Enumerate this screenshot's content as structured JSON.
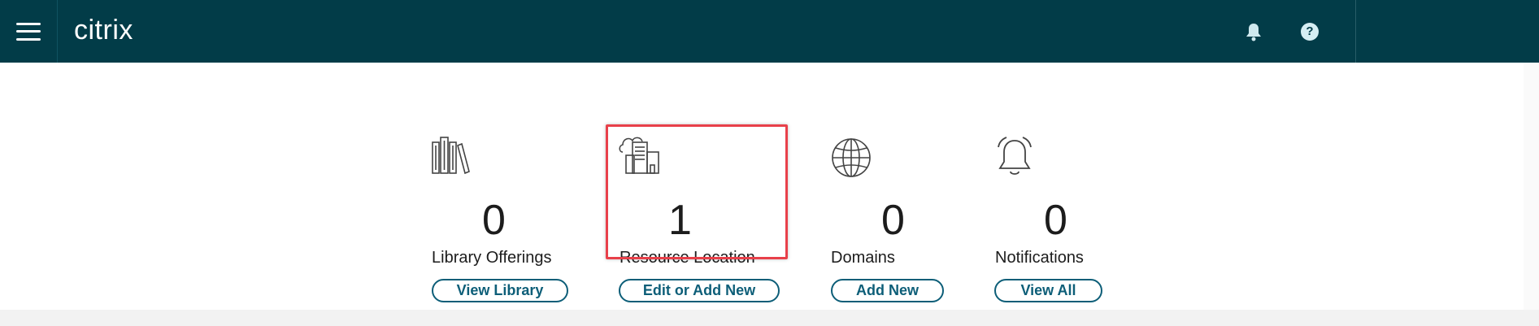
{
  "header": {
    "brand": "citrix",
    "icons": {
      "menu": "hamburger-menu-icon",
      "bell": "bell-icon",
      "help": "help-icon"
    },
    "help_glyph": "?",
    "background": "#023c48"
  },
  "cards": [
    {
      "icon": "library-books-icon",
      "count": "0",
      "label": "Library Offerings",
      "button": "View Library"
    },
    {
      "icon": "cloud-building-icon",
      "count": "1",
      "label": "Resource Location",
      "button": "Edit or Add New"
    },
    {
      "icon": "globe-icon",
      "count": "0",
      "label": "Domains",
      "button": "Add New"
    },
    {
      "icon": "alarm-bell-icon",
      "count": "0",
      "label": "Notifications",
      "button": "View All"
    }
  ],
  "colors": {
    "accent": "#0d5e78",
    "highlight": "#e8404a"
  }
}
